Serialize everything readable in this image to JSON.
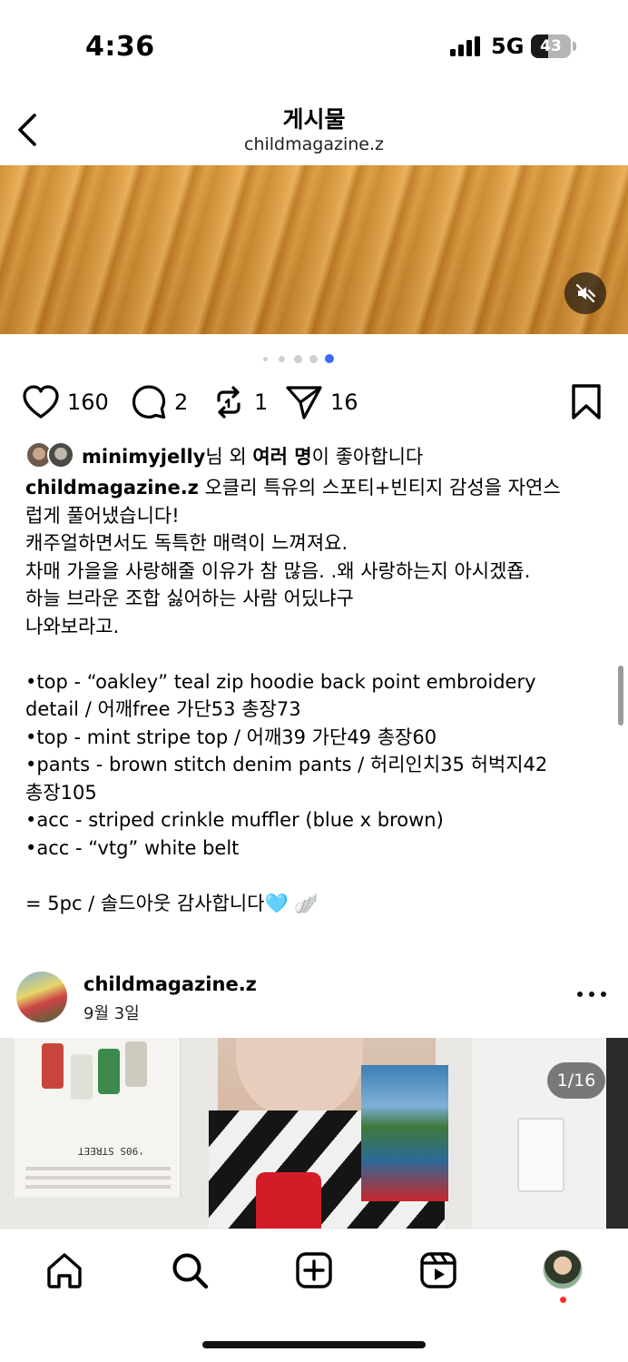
{
  "status_bar": {
    "time": "4:36",
    "network": "5G",
    "battery": "43"
  },
  "header": {
    "title": "게시물",
    "subtitle": "childmagazine.z"
  },
  "carousel": {
    "dot_count": 5,
    "active_index": 4,
    "accent_color": "#3b6cf4"
  },
  "actions": {
    "likes": "160",
    "comments": "2",
    "reposts": "1",
    "shares": "16"
  },
  "liked_by": {
    "user": "minimyjelly",
    "mid": "님 외 ",
    "others": "여러 명",
    "suffix": "이 좋아합니다"
  },
  "caption": {
    "author": "childmagazine.z",
    "first_line_rest": " 오클리 특유의 스포티+빈티지 감성을 자연스",
    "lines": [
      "럽게 풀어냈습니다!",
      "캐주얼하면서도 독특한 매력이 느껴져요.",
      "차매 가을을 사랑해줄 이유가 참 많음. .왜 사랑하는지 아시겠죱.",
      "하늘 브라운 조합 싫어하는 사람 어딨냐구",
      "나와보라고.",
      "",
      "•top - “oakley” teal zip hoodie back point embroidery",
      "detail / 어깨free 가단53 총장73",
      "•top - mint stripe top / 어깨39 가단49 총장60",
      "•pants - brown stitch denim pants / 허리인치35 허벅지42",
      "총장105",
      "•acc - striped crinkle muffler (blue x brown)",
      "•acc - “vtg” white belt",
      "",
      "= 5pc / 솔드아웃 감사합니다🩵 🪽"
    ]
  },
  "next_post": {
    "username": "childmagazine.z",
    "date": "9월 3일",
    "counter": "1/16",
    "poster_text": "'90S STREET"
  }
}
